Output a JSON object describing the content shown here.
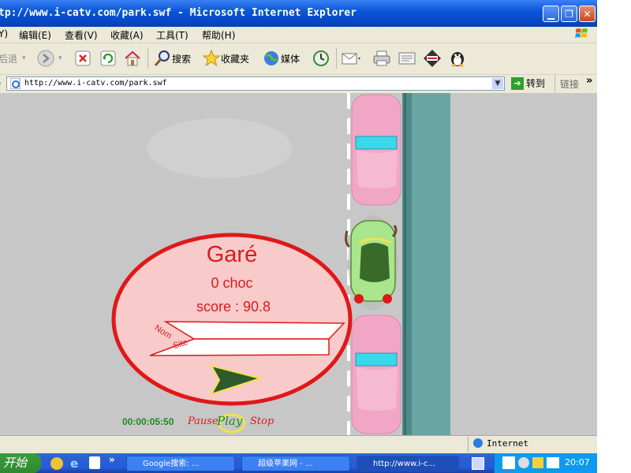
{
  "window": {
    "title": "tp://www.i-catv.com/park.swf - Microsoft Internet Explorer"
  },
  "menu": {
    "items": [
      "Y)",
      "编辑(E)",
      "查看(V)",
      "收藏(A)",
      "工具(T)",
      "帮助(H)"
    ]
  },
  "toolbar": {
    "back_label": "后退",
    "search_label": "搜索",
    "favorites_label": "收藏夹",
    "media_label": "媒体"
  },
  "address": {
    "url": "http://www.i-catv.com/park.swf",
    "go_label": "转到",
    "links_label": "链接",
    "chevron": "»"
  },
  "game": {
    "status_title": "Garé",
    "shocks": "0 choc",
    "score": "score : 90.8",
    "nom_label": "Nom",
    "site_label": "Site",
    "timer": "00:00:05:50",
    "pause_label": "Pause",
    "play_label": "Play",
    "stop_label": "Stop",
    "colors": {
      "accent_red": "#e01818",
      "oval_fill": "#f8caca",
      "parked_car": "#f2a6c6",
      "player_car": "#a9e58c",
      "sidewalk": "#6aa5a5",
      "asphalt": "#c7c7c7",
      "arrow": "#2e5a2e",
      "timer_green": "#1f8a1f"
    }
  },
  "statusbar": {
    "left": "",
    "zone": "Internet"
  },
  "taskbar": {
    "start_label": "开始",
    "quick_chevron": "»",
    "tasks": [
      "Google搜索: ...",
      "超级苹果网 - ...",
      "http://www.i-c..."
    ],
    "clock": "20:07"
  }
}
